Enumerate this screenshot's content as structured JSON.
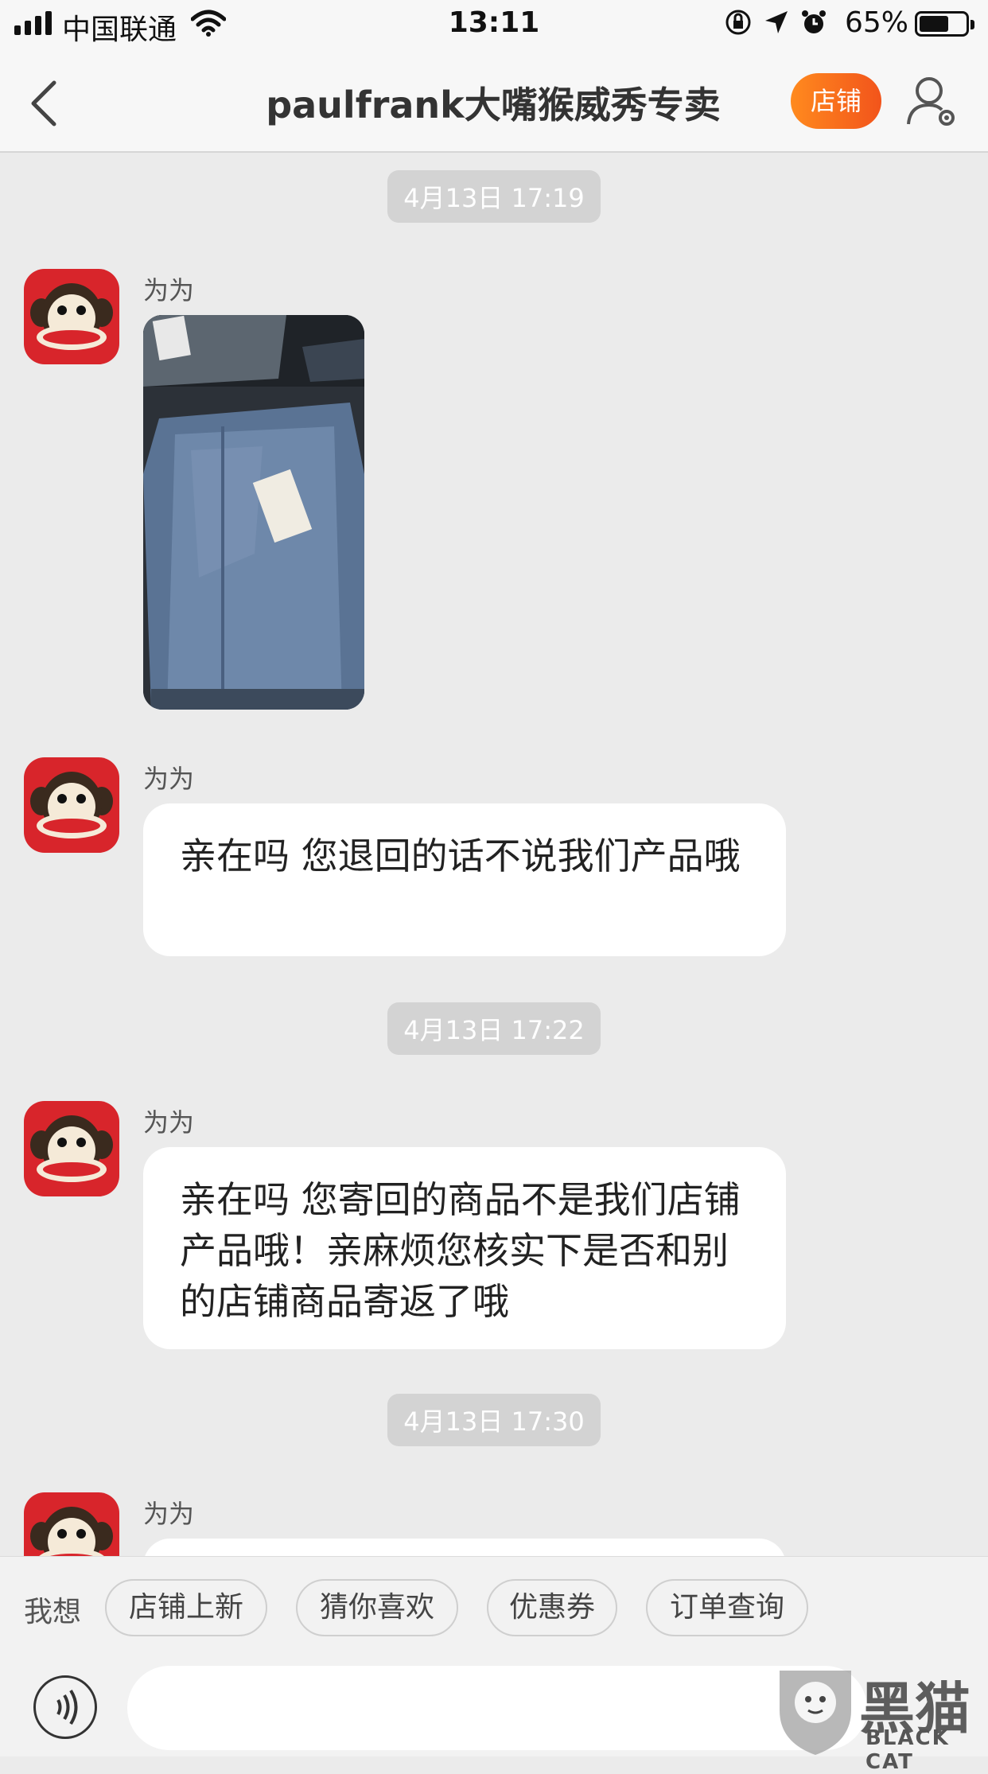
{
  "status_bar": {
    "carrier": "中国联通",
    "time": "13:11",
    "battery": "65%",
    "battery_level": 0.65
  },
  "header": {
    "title": "paulfrank大嘴猴威秀专卖",
    "store_button": "店铺"
  },
  "messages": [
    {
      "timestamp": "4月13日 17:19",
      "sender": "为为",
      "kind": "image"
    },
    {
      "sender": "为为",
      "kind": "text",
      "text": "亲在吗 您退回的话不说我们产品哦"
    },
    {
      "timestamp": "4月13日 17:22",
      "sender": "为为",
      "kind": "text",
      "text": "亲在吗 您寄回的商品不是我们店铺产品哦！亲麻烦您核实下是否和别的店铺商品寄返了哦"
    },
    {
      "timestamp": "4月13日 17:30",
      "sender": "为为",
      "kind": "text",
      "text": ""
    }
  ],
  "quick_bar": {
    "label": "我想",
    "chips": [
      "店铺上新",
      "猜你喜欢",
      "优惠券",
      "订单查询"
    ]
  },
  "watermark": {
    "text_en": "BLACK CAT",
    "text_cn": "黑猫"
  },
  "colors": {
    "accent": "#f2541b",
    "avatar_bg": "#d8252b",
    "background": "#ebebeb"
  }
}
